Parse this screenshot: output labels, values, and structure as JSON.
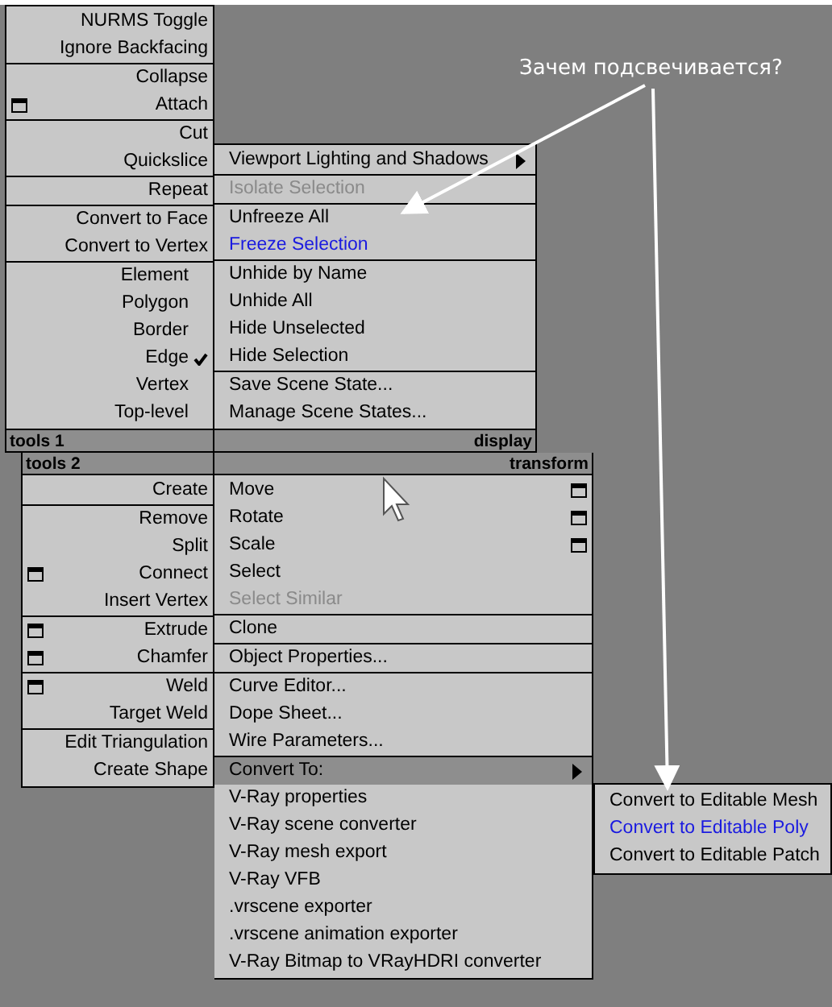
{
  "quadrants": [
    {
      "title": "tools 1",
      "groups": [
        [
          {
            "label": "NURMS Toggle",
            "kind": "normal"
          },
          {
            "label": "Ignore Backfacing",
            "kind": "normal"
          }
        ],
        [
          {
            "label": "Collapse",
            "kind": "normal"
          },
          {
            "label": "Attach",
            "kind": "normal",
            "options": true
          }
        ],
        [
          {
            "label": "Cut",
            "kind": "normal"
          },
          {
            "label": "Quickslice",
            "kind": "normal"
          }
        ],
        [
          {
            "label": "Repeat",
            "kind": "normal"
          }
        ],
        [
          {
            "label": "Convert to Face",
            "kind": "normal"
          },
          {
            "label": "Convert to Vertex",
            "kind": "normal"
          }
        ],
        [
          {
            "label": "Element",
            "kind": "normal",
            "checked": false
          },
          {
            "label": "Polygon",
            "kind": "normal",
            "checked": false
          },
          {
            "label": "Border",
            "kind": "normal",
            "checked": false
          },
          {
            "label": "Edge",
            "kind": "normal",
            "checked": true
          },
          {
            "label": "Vertex",
            "kind": "normal",
            "checked": false
          },
          {
            "label": "Top-level",
            "kind": "normal",
            "checked": false
          }
        ]
      ]
    },
    {
      "title": "display",
      "groups": [
        [
          {
            "label": "Viewport Lighting and Shadows",
            "kind": "normal",
            "submenu": true
          }
        ],
        [
          {
            "label": "Isolate Selection",
            "kind": "disabled"
          }
        ],
        [
          {
            "label": "Unfreeze All",
            "kind": "normal"
          },
          {
            "label": "Freeze Selection",
            "kind": "highlighted"
          }
        ],
        [
          {
            "label": "Unhide by Name",
            "kind": "normal"
          },
          {
            "label": "Unhide All",
            "kind": "normal"
          },
          {
            "label": "Hide Unselected",
            "kind": "normal"
          },
          {
            "label": "Hide Selection",
            "kind": "normal"
          }
        ],
        [
          {
            "label": "Save Scene State...",
            "kind": "normal"
          },
          {
            "label": "Manage Scene States...",
            "kind": "normal"
          }
        ]
      ]
    },
    {
      "title": "tools 2",
      "groups": [
        [
          {
            "label": "Create",
            "kind": "normal"
          }
        ],
        [
          {
            "label": "Remove",
            "kind": "normal"
          },
          {
            "label": "Split",
            "kind": "normal"
          },
          {
            "label": "Connect",
            "kind": "normal",
            "options": true
          },
          {
            "label": "Insert Vertex",
            "kind": "normal"
          }
        ],
        [
          {
            "label": "Extrude",
            "kind": "normal",
            "options": true
          },
          {
            "label": "Chamfer",
            "kind": "normal",
            "options": true
          }
        ],
        [
          {
            "label": "Weld",
            "kind": "normal",
            "options": true
          },
          {
            "label": "Target Weld",
            "kind": "normal"
          }
        ],
        [
          {
            "label": "Edit Triangulation",
            "kind": "normal"
          },
          {
            "label": "Create Shape",
            "kind": "normal"
          }
        ]
      ]
    },
    {
      "title": "transform",
      "groups": [
        [
          {
            "label": "Move",
            "kind": "normal",
            "options": true
          },
          {
            "label": "Rotate",
            "kind": "normal",
            "options": true
          },
          {
            "label": "Scale",
            "kind": "normal",
            "options": true
          },
          {
            "label": "Select",
            "kind": "normal"
          },
          {
            "label": "Select Similar",
            "kind": "disabled"
          }
        ],
        [
          {
            "label": "Clone",
            "kind": "normal"
          }
        ],
        [
          {
            "label": "Object Properties...",
            "kind": "normal"
          }
        ],
        [
          {
            "label": "Curve Editor...",
            "kind": "normal"
          },
          {
            "label": "Dope Sheet...",
            "kind": "normal"
          },
          {
            "label": "Wire Parameters...",
            "kind": "normal"
          }
        ],
        [
          {
            "label": "Convert To:",
            "kind": "hover",
            "submenu": true
          },
          {
            "label": "V-Ray properties",
            "kind": "normal"
          },
          {
            "label": "V-Ray scene converter",
            "kind": "normal"
          },
          {
            "label": "V-Ray mesh export",
            "kind": "normal"
          },
          {
            "label": "V-Ray VFB",
            "kind": "normal"
          },
          {
            "label": ".vrscene exporter",
            "kind": "normal"
          },
          {
            "label": ".vrscene animation exporter",
            "kind": "normal"
          },
          {
            "label": "V-Ray Bitmap to VRayHDRI converter",
            "kind": "normal"
          }
        ]
      ]
    }
  ],
  "submenu": [
    {
      "label": "Convert to Editable Mesh",
      "kind": "normal"
    },
    {
      "label": "Convert to Editable Poly",
      "kind": "highlighted"
    },
    {
      "label": "Convert to Editable Patch",
      "kind": "normal"
    }
  ],
  "annotation": "Зачем подсвечивается?"
}
